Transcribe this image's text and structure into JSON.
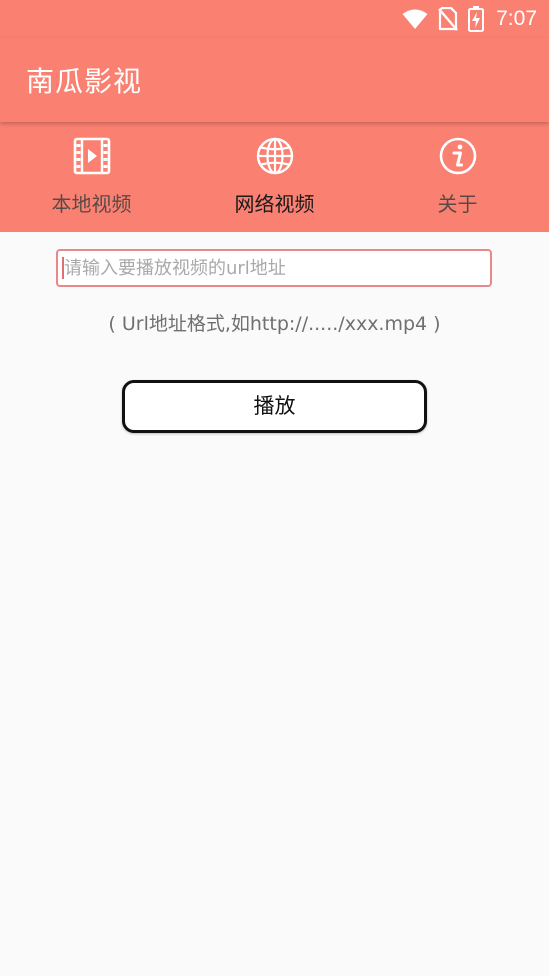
{
  "status_bar": {
    "time": "7:07",
    "icons": [
      "wifi-icon",
      "no-sim-icon",
      "battery-charging-icon"
    ]
  },
  "app_bar": {
    "title": "南瓜影视"
  },
  "tabs": [
    {
      "label": "本地视频",
      "icon": "film-icon",
      "active": false
    },
    {
      "label": "网络视频",
      "icon": "globe-icon",
      "active": true
    },
    {
      "label": "关于",
      "icon": "info-icon",
      "active": false
    }
  ],
  "network_video": {
    "url_input": {
      "value": "",
      "placeholder": "请输入要播放视频的url地址"
    },
    "hint": "( Url地址格式,如http://...../xxx.mp4 )",
    "play_label": "播放"
  },
  "colors": {
    "primary": "#fa8072",
    "background": "#fafafa",
    "input_border": "#e88888"
  }
}
